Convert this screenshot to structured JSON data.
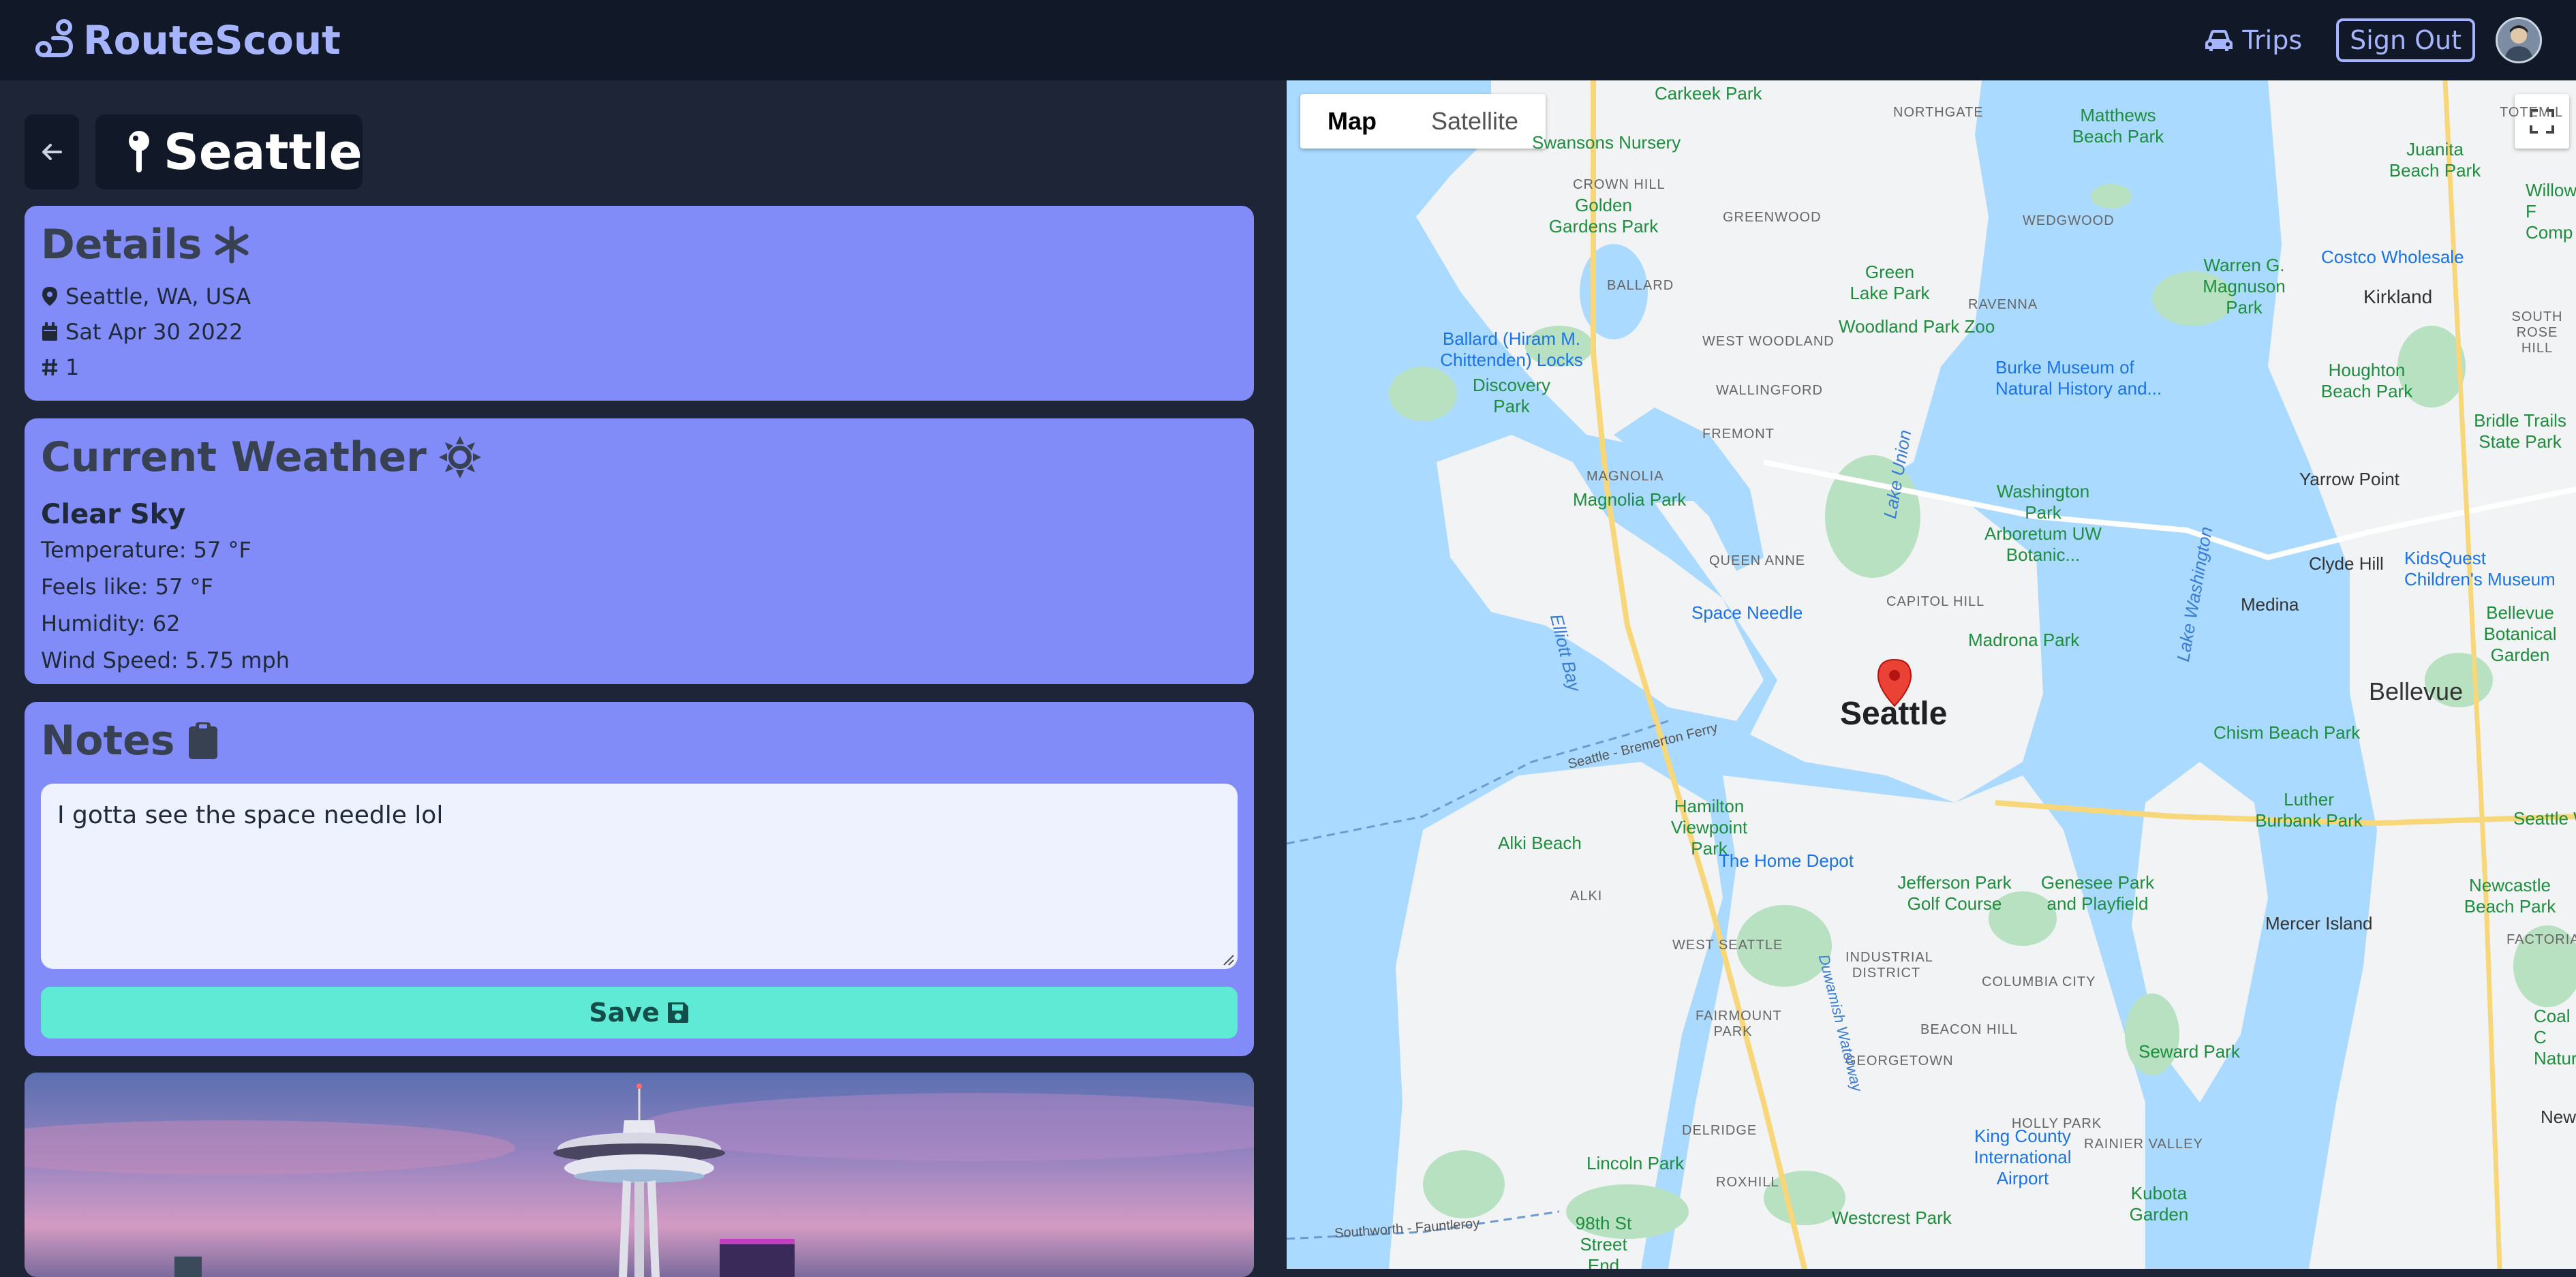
{
  "navbar": {
    "brand": "RouteScout",
    "trips_label": "Trips",
    "signout_label": "Sign Out"
  },
  "page": {
    "title": "Seattle"
  },
  "details": {
    "heading": "Details",
    "location": "Seattle, WA, USA",
    "date": "Sat Apr 30 2022",
    "number": "1"
  },
  "weather": {
    "heading": "Current Weather",
    "condition": "Clear Sky",
    "temperature": "Temperature: 57 °F",
    "feels_like": "Feels like: 57 °F",
    "humidity": "Humidity: 62",
    "wind_speed": "Wind Speed: 5.75 mph"
  },
  "notes": {
    "heading": "Notes",
    "text": "I gotta see the space needle lol",
    "save_label": "Save"
  },
  "map": {
    "type_map": "Map",
    "type_satellite": "Satellite",
    "city_label": "Seattle",
    "labels": {
      "northgate": "NORTHGATE",
      "crown_hill": "CROWN HILL",
      "greenwood": "GREENWOOD",
      "wedgwood": "WEDGWOOD",
      "ballard": "BALLARD",
      "ravenna": "RAVENNA",
      "west_woodland": "WEST WOODLAND",
      "wallingford": "WALLINGFORD",
      "fremont": "FREMONT",
      "magnolia": "MAGNOLIA",
      "queen_anne": "QUEEN ANNE",
      "capitol_hill": "CAPITOL HILL",
      "alki": "ALKI",
      "west_seattle": "WEST SEATTLE",
      "industrial_district": "INDUSTRIAL DISTRICT",
      "columbia_city": "COLUMBIA CITY",
      "fairmount_park": "FAIRMOUNT PARK",
      "beacon_hill": "BEACON HILL",
      "georgetown": "GEORGETOWN",
      "delridge": "DELRIDGE",
      "roxhill": "ROXHILL",
      "holly_park": "HOLLY PARK",
      "rainier_valley": "RAINIER VALLEY",
      "totem_lake": "TOTEM L",
      "south_rose_hill": "SOUTH ROSE HILL",
      "factoria": "FACTORIA",
      "carkeek": "Carkeek Park",
      "swansons": "Swansons Nursery",
      "golden_gardens": "Golden Gardens Park",
      "matthews": "Matthews Beach Park",
      "green_lake": "Green Lake Park",
      "warren": "Warren G. Magnuson Park",
      "woodland_zoo": "Woodland Park Zoo",
      "ballard_locks": "Ballard (Hiram M. Chittenden) Locks",
      "discovery": "Discovery Park",
      "burke": "Burke Museum of Natural History and...",
      "magnolia_park": "Magnolia Park",
      "washington_park": "Washington Park Arboretum UW Botanic...",
      "space_needle": "Space Needle",
      "madrona": "Madrona Park",
      "hamilton": "Hamilton Viewpoint Park",
      "alki_beach": "Alki Beach",
      "home_depot": "The Home Depot",
      "jefferson": "Jefferson Park Golf Course",
      "genesee": "Genesee Park and Playfield",
      "seward": "Seward Park",
      "king_county": "King County International Airport",
      "lincoln": "Lincoln Park",
      "westcrest": "Westcrest Park",
      "kubota": "Kubota Garden",
      "98th": "98th St Street End",
      "juanita": "Juanita Beach Park",
      "willows": "Willows F Comp",
      "costco": "Costco Wholesale",
      "kirkland": "Kirkland",
      "houghton": "Houghton Beach Park",
      "bridle": "Bridle Trails State Park",
      "yarrow": "Yarrow Point",
      "clyde": "Clyde Hill",
      "medina": "Medina",
      "kidsquest": "KidsQuest Children's Museum",
      "bellevue_botanical": "Bellevue Botanical Garden",
      "bellevue": "Bellevue",
      "chism": "Chism Beach Park",
      "luther": "Luther Burbank Park",
      "seattle_wa": "Seattle Wa",
      "newcastle": "Newcastle Beach Park",
      "mercer": "Mercer Island",
      "coal_creek": "Coal C Natura",
      "newc": "Newc",
      "lake_union": "Lake Union",
      "lake_washington": "Lake Washington",
      "elliott_bay": "Elliott Bay",
      "duwamish": "Duwamish Waterway",
      "ferry": "Seattle - Bremerton Ferry",
      "southworth": "Southworth - Fauntleroy"
    }
  }
}
